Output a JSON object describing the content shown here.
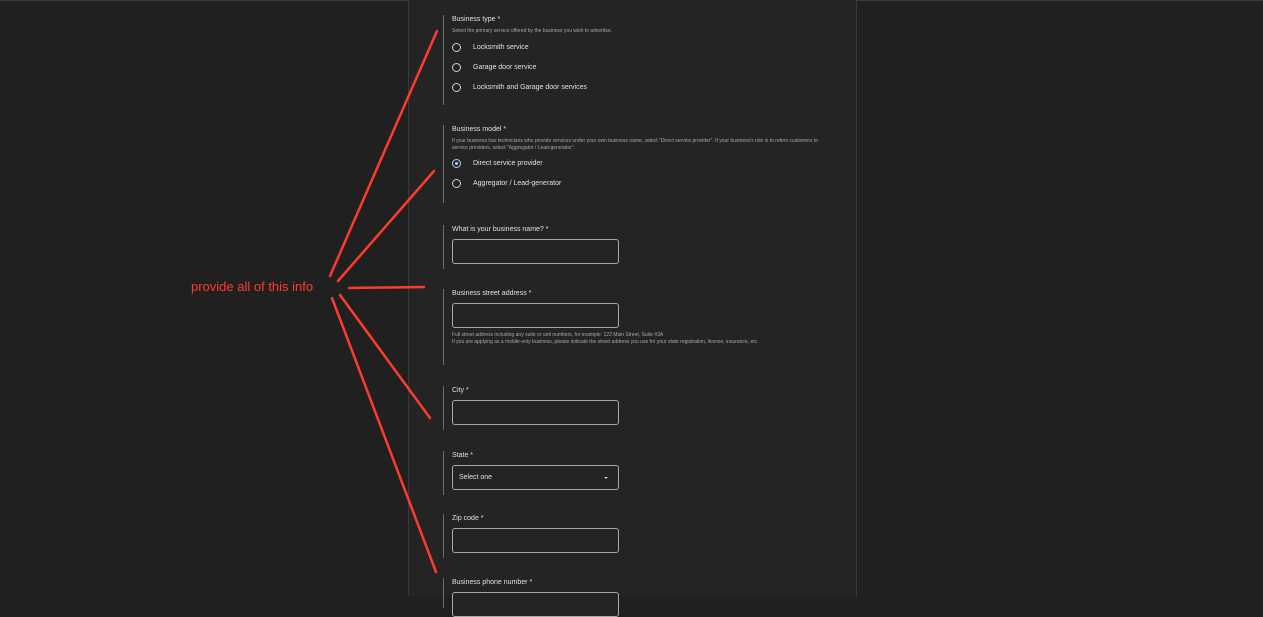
{
  "annotation": {
    "text": "provide all of this info",
    "color": "#ff3b2f"
  },
  "form": {
    "business_type": {
      "label": "Business type *",
      "help": "Select the primary service offered by the business you wish to advertise.",
      "options": [
        "Locksmith service",
        "Garage door service",
        "Locksmith and Garage door services"
      ],
      "selected": null
    },
    "business_model": {
      "label": "Business model *",
      "help": "If your business has technicians who provide services under your own business name, select \"Direct service provider\".  If your business's role is to refers customers to service providers, select \"Aggregator / Lead-generator\".",
      "options": [
        "Direct service provider",
        "Aggregator / Lead-generator"
      ],
      "selected": "Direct service provider"
    },
    "business_name": {
      "label": "What is your business name? *",
      "value": ""
    },
    "street_address": {
      "label": "Business street address *",
      "value": "",
      "help": "Full street address including any suite or unit numbers, for example: 123 Main Street, Suite #3A\nIf you are applying as a mobile-only business, please indicate the street address you use for your state registration, license, insurance, etc."
    },
    "city": {
      "label": "City *",
      "value": ""
    },
    "state": {
      "label": "State *",
      "value": "Select one"
    },
    "zip": {
      "label": "Zip code *",
      "value": ""
    },
    "phone": {
      "label": "Business phone number *",
      "value": ""
    }
  }
}
